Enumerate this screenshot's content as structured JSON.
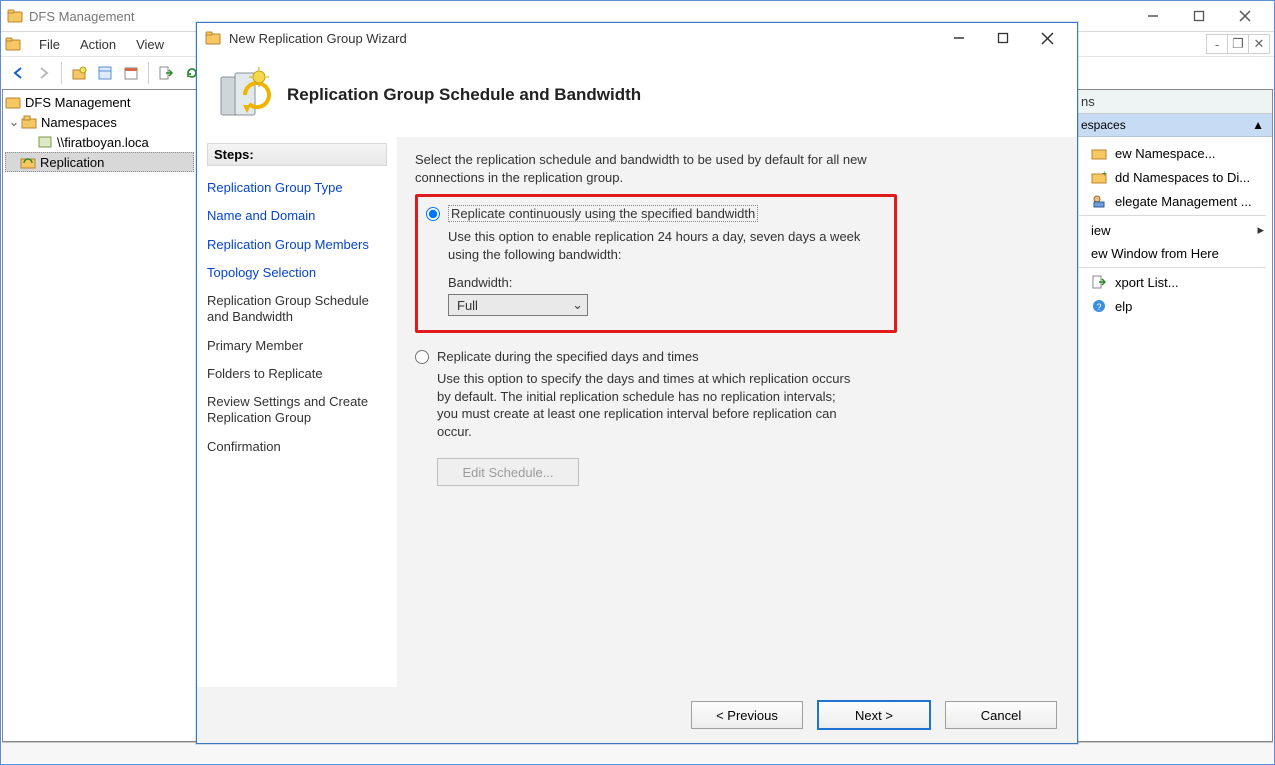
{
  "mmc": {
    "title": "DFS Management",
    "menus": [
      "File",
      "Action",
      "View"
    ],
    "tree": {
      "root": "DFS Management",
      "namespaces": "Namespaces",
      "ns_server": "\\\\firatboyan.loca",
      "replication": "Replication"
    },
    "actions": {
      "header": "ns",
      "group": "espaces",
      "items": {
        "new_ns": "ew Namespace...",
        "add_ns": "dd Namespaces to Di...",
        "delegate": "elegate Management ...",
        "view": "iew",
        "new_window": "ew Window from Here",
        "export": "xport List...",
        "help": "elp"
      }
    }
  },
  "wizard": {
    "title": "New Replication Group Wizard",
    "heading": "Replication Group Schedule and Bandwidth",
    "steps_label": "Steps:",
    "steps": {
      "type": "Replication Group Type",
      "name": "Name and Domain",
      "members": "Replication Group Members",
      "topology": "Topology Selection",
      "schedule": "Replication Group Schedule and Bandwidth",
      "primary": "Primary Member",
      "folders": "Folders to Replicate",
      "review": "Review Settings and Create Replication Group",
      "confirm": "Confirmation"
    },
    "intro": "Select the replication schedule and bandwidth to be used by default for all new connections in the replication group.",
    "option1": {
      "label": "Replicate continuously using the specified bandwidth",
      "desc": "Use this option to enable replication 24 hours a day, seven days a week using the following bandwidth:",
      "bw_label": "Bandwidth:",
      "bw_value": "Full"
    },
    "option2": {
      "label": "Replicate during the specified days and times",
      "desc": "Use this option to specify the days and times at which replication occurs by default. The initial replication schedule has no replication intervals; you must create at least one replication interval before replication can occur."
    },
    "edit_schedule": "Edit Schedule...",
    "buttons": {
      "previous": "< Previous",
      "next": "Next >",
      "cancel": "Cancel"
    }
  }
}
